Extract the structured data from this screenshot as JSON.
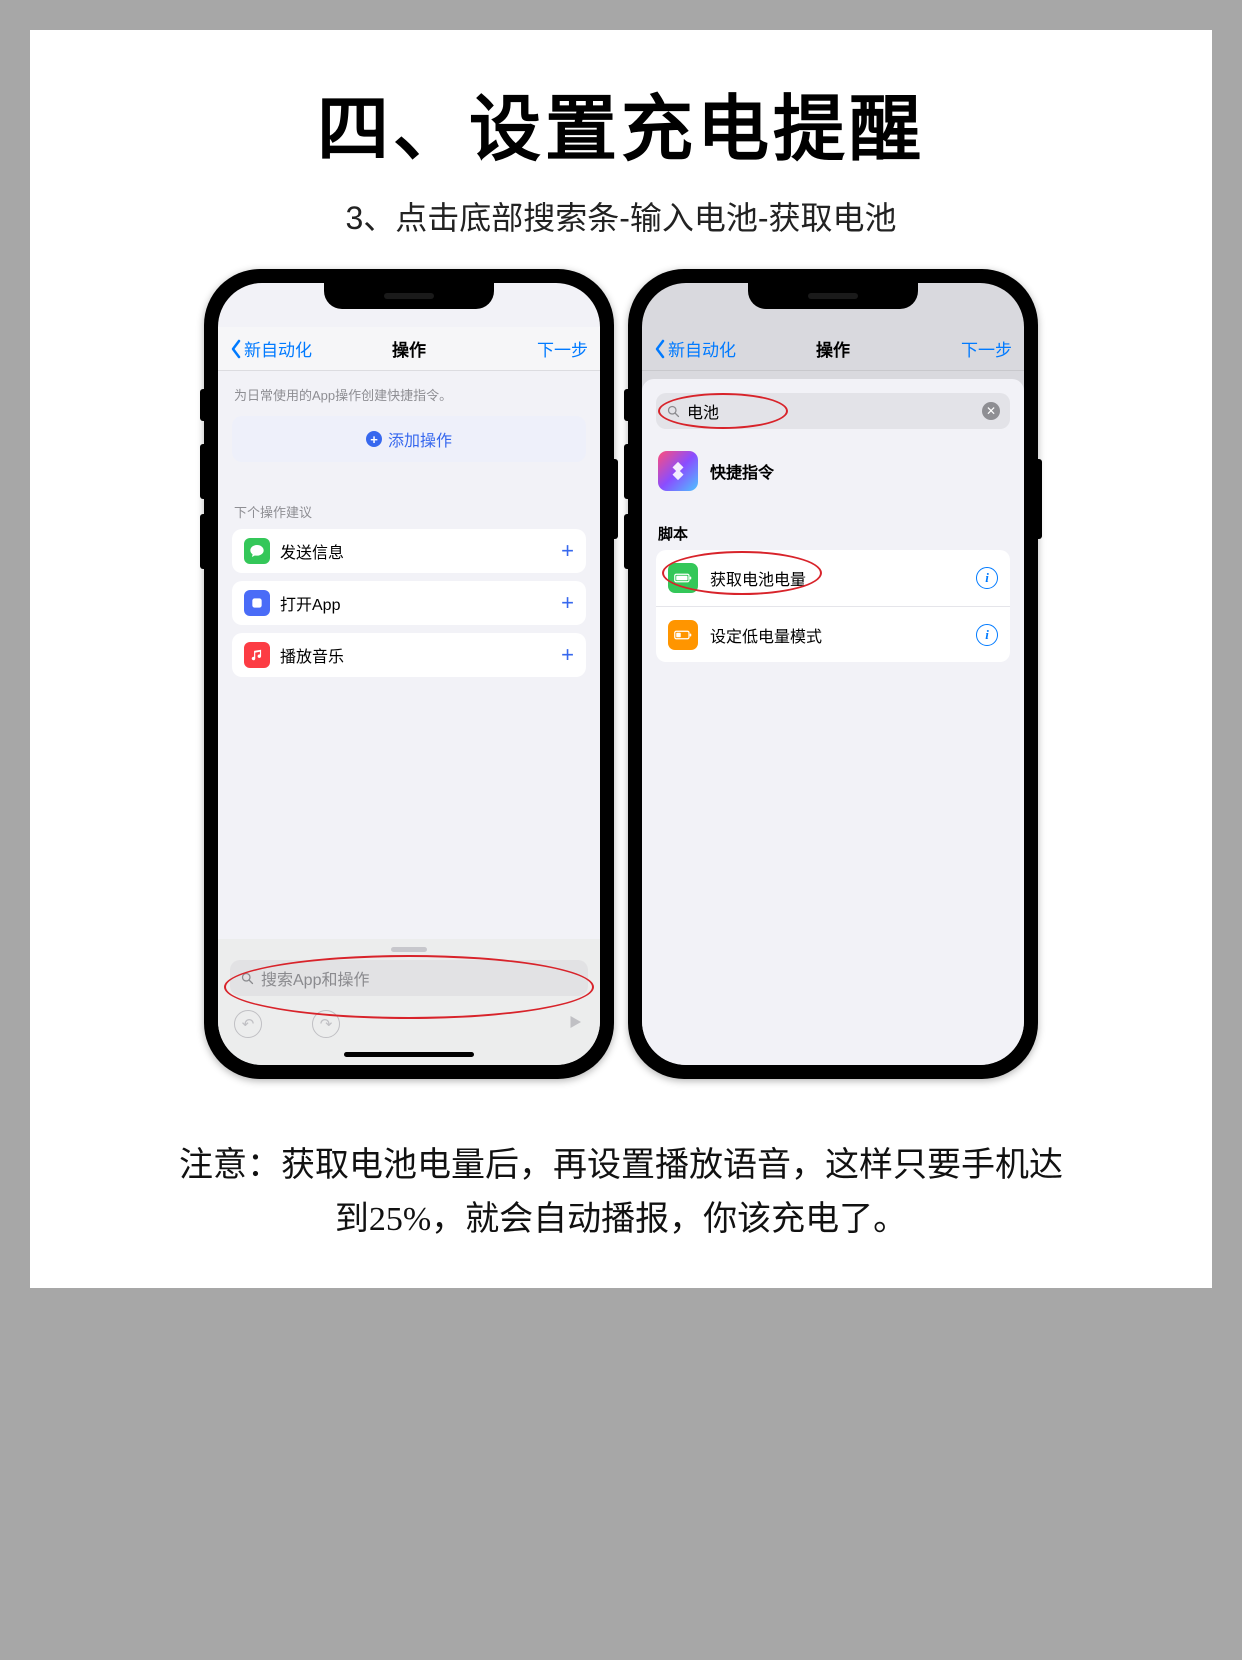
{
  "page": {
    "title": "四、设置充电提醒",
    "subtitle": "3、点击底部搜索条-输入电池-获取电池",
    "note_line1": "注意：获取电池电量后，再设置播放语音，这样只要手机达",
    "note_line2": "到25%，就会自动播报，你该充电了。"
  },
  "phone1": {
    "nav": {
      "back": "新自动化",
      "title": "操作",
      "next": "下一步"
    },
    "hint": "为日常使用的App操作创建快捷指令。",
    "add_action": "添加操作",
    "section_label": "下个操作建议",
    "suggestions": [
      {
        "label": "发送信息",
        "icon_bg": "#34c759"
      },
      {
        "label": "打开App",
        "icon_bg": "#4a6cf7"
      },
      {
        "label": "播放音乐",
        "icon_bg": "#fc3c44"
      }
    ],
    "search_placeholder": "搜索App和操作"
  },
  "phone2": {
    "nav": {
      "back": "新自动化",
      "title": "操作",
      "next": "下一步"
    },
    "search_value": "电池",
    "shortcuts_label": "快捷指令",
    "section_label": "脚本",
    "options": [
      {
        "label": "获取电池电量",
        "icon_bg": "#34c759"
      },
      {
        "label": "设定低电量模式",
        "icon_bg": "#ff9500"
      }
    ]
  }
}
